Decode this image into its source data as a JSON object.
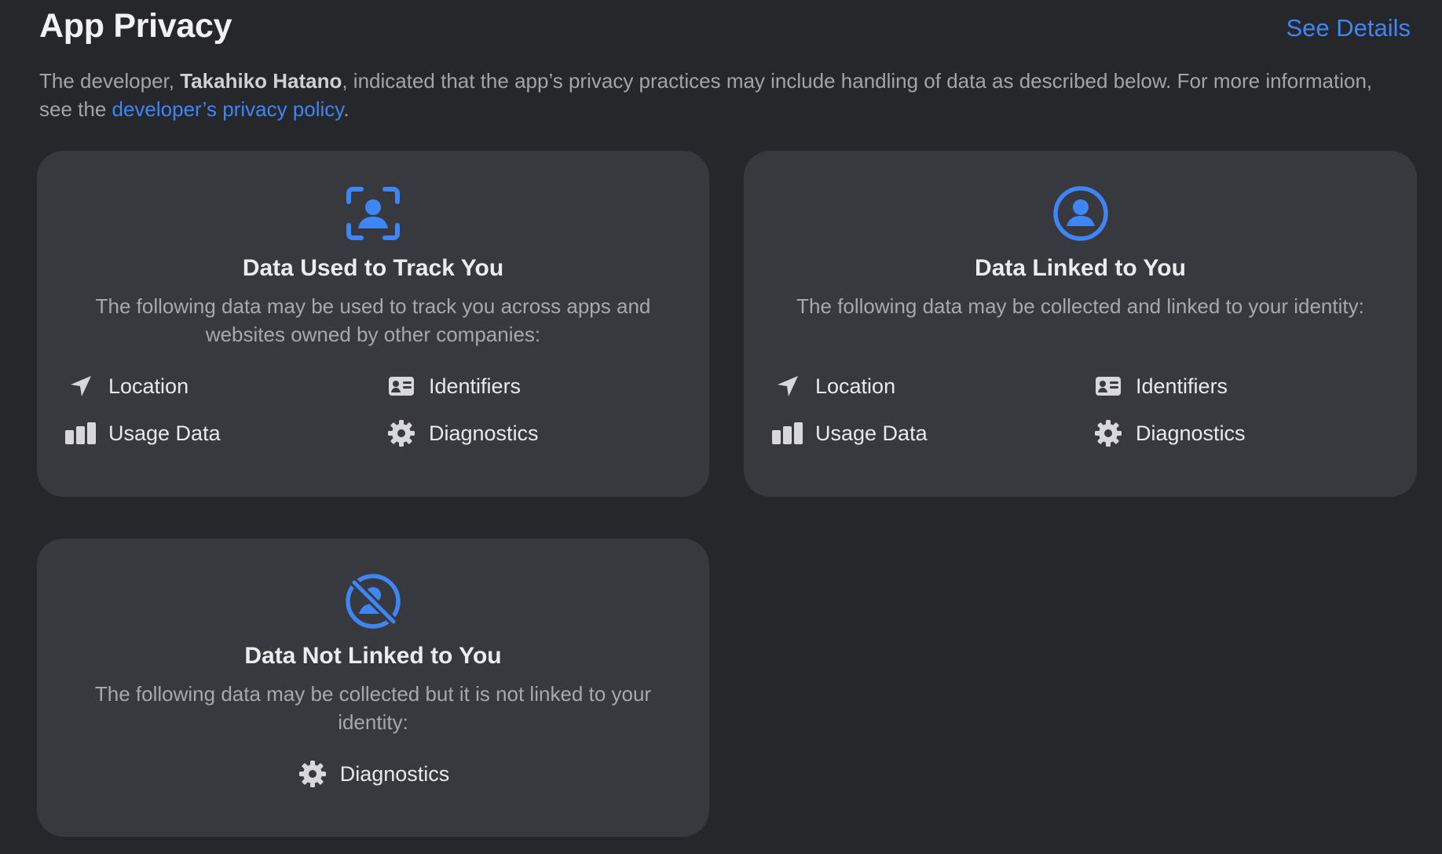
{
  "header": {
    "title": "App Privacy",
    "see_details": "See Details"
  },
  "intro": {
    "prefix": "The developer, ",
    "developer": "Takahiko Hatano",
    "middle": ", indicated that the app’s privacy practices may include handling of data as described below. For more information, see the ",
    "link": "developer’s privacy policy",
    "suffix": "."
  },
  "cards": {
    "track": {
      "icon": "person-viewfinder-icon",
      "title": "Data Used to Track You",
      "description": "The following data may be used to track you across apps and websites owned by other companies:",
      "items": [
        {
          "icon": "location-arrow-icon",
          "label": "Location"
        },
        {
          "icon": "id-card-icon",
          "label": "Identifiers"
        },
        {
          "icon": "usage-bars-icon",
          "label": "Usage Data"
        },
        {
          "icon": "gear-icon",
          "label": "Diagnostics"
        }
      ]
    },
    "linked": {
      "icon": "person-circle-icon",
      "title": "Data Linked to You",
      "description": "The following data may be collected and linked to your identity:",
      "items": [
        {
          "icon": "location-arrow-icon",
          "label": "Location"
        },
        {
          "icon": "id-card-icon",
          "label": "Identifiers"
        },
        {
          "icon": "usage-bars-icon",
          "label": "Usage Data"
        },
        {
          "icon": "gear-icon",
          "label": "Diagnostics"
        }
      ]
    },
    "not_linked": {
      "icon": "person-circle-slash-icon",
      "title": "Data Not Linked to You",
      "description": "The following data may be collected but it is not linked to your identity:",
      "items": [
        {
          "icon": "gear-icon",
          "label": "Diagnostics"
        }
      ]
    }
  },
  "colors": {
    "background": "#26272b",
    "card": "#38393e",
    "accent": "#3e86f5",
    "secondary_text": "#a7a8ae"
  }
}
